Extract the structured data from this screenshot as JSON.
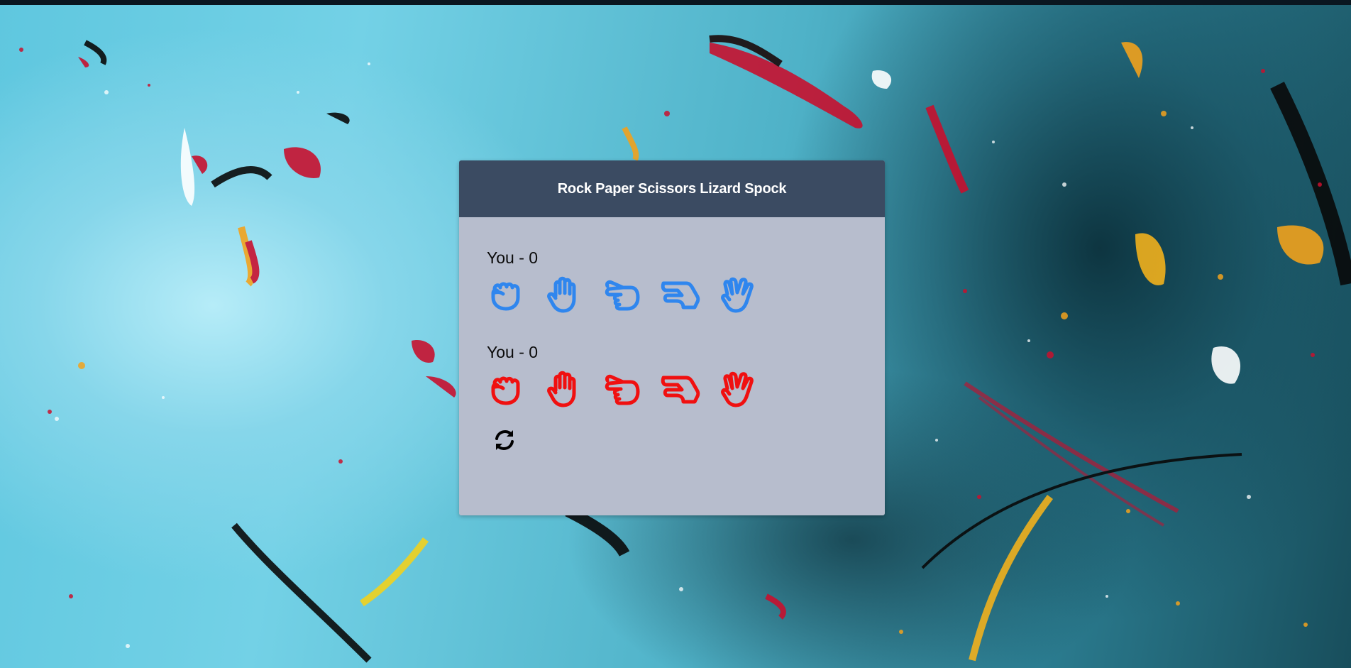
{
  "game": {
    "title": "Rock Paper Scissors Lizard Spock"
  },
  "players": [
    {
      "label": "You - 0",
      "color": "#2f86ee"
    },
    {
      "label": "You - 0",
      "color": "#f01010"
    }
  ],
  "hands": [
    {
      "name": "rock",
      "icon": "hand-rock-icon"
    },
    {
      "name": "paper",
      "icon": "hand-paper-icon"
    },
    {
      "name": "scissors",
      "icon": "hand-scissors-icon"
    },
    {
      "name": "lizard",
      "icon": "hand-lizard-icon"
    },
    {
      "name": "spock",
      "icon": "hand-spock-icon"
    }
  ],
  "controls": {
    "reset_icon": "refresh-icon"
  },
  "colors": {
    "header_bg": "#3b4b62",
    "card_bg": "#b7bdcd"
  }
}
